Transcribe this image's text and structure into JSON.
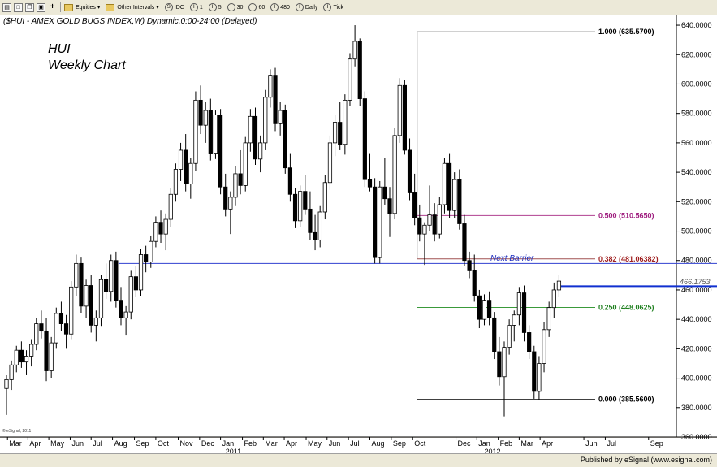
{
  "toolbar": {
    "items": [
      "Equities",
      "Other Intervals",
      "IDC",
      "1",
      "5",
      "30",
      "60",
      "480",
      "Daily",
      "Tick"
    ]
  },
  "chart_data": {
    "type": "candlestick",
    "header": "($HUI - AMEX GOLD BUGS INDEX,W) Dynamic,0:00-24:00 (Delayed)",
    "annotation_title": [
      "HUI",
      "Weekly Chart"
    ],
    "ylim": [
      360,
      645
    ],
    "yticks": [
      360,
      380,
      400,
      420,
      440,
      460,
      480,
      500,
      520,
      540,
      560,
      580,
      600,
      620,
      640
    ],
    "ytick_labels": [
      "360.0000",
      "380.0000",
      "400.0000",
      "420.0000",
      "440.0000",
      "460.0000",
      "480.0000",
      "500.0000",
      "520.0000",
      "540.0000",
      "560.0000",
      "580.0000",
      "600.0000",
      "620.0000",
      "640.0000"
    ],
    "last_price": "466.1753",
    "x_months": [
      {
        "label": "Mar",
        "x": 0.2
      },
      {
        "label": "Apr",
        "x": 4.3
      },
      {
        "label": "May",
        "x": 8.5
      },
      {
        "label": "Jun",
        "x": 12.8
      },
      {
        "label": "Jul",
        "x": 17.0
      },
      {
        "label": "Aug",
        "x": 21.3
      },
      {
        "label": "Sep",
        "x": 25.7
      },
      {
        "label": "Oct",
        "x": 30.0
      },
      {
        "label": "Nov",
        "x": 34.5
      },
      {
        "label": "Dec",
        "x": 38.8
      },
      {
        "label": "Jan",
        "x": 43.0
      },
      {
        "label": "Feb",
        "x": 47.4
      },
      {
        "label": "Mar",
        "x": 51.6
      },
      {
        "label": "Apr",
        "x": 55.8
      },
      {
        "label": "May",
        "x": 60.2
      },
      {
        "label": "Jun",
        "x": 64.4
      },
      {
        "label": "Jul",
        "x": 68.7
      },
      {
        "label": "Aug",
        "x": 73.0
      },
      {
        "label": "Sep",
        "x": 77.3
      },
      {
        "label": "Oct",
        "x": 81.6
      },
      {
        "label": "Dec",
        "x": 90.3
      },
      {
        "label": "Jan",
        "x": 94.5
      },
      {
        "label": "Feb",
        "x": 98.8
      },
      {
        "label": "Mar",
        "x": 103.0
      },
      {
        "label": "Apr",
        "x": 107.2
      },
      {
        "label": "Jun",
        "x": 116.0
      },
      {
        "label": "Jul",
        "x": 120.3
      },
      {
        "label": "Sep",
        "x": 129.0
      }
    ],
    "x_years": [
      {
        "label": "2011",
        "x": 44.0
      },
      {
        "label": "2012",
        "x": 96.0
      }
    ],
    "fib_levels": [
      {
        "label": "1.000 (635.5700)",
        "value": 635.57,
        "x_start": 82.5,
        "color": "#808080",
        "text_color": "#000000"
      },
      {
        "label": "0.500 (510.5650)",
        "value": 510.565,
        "x_start": 82.5,
        "color": "#b04090",
        "text_color": "#a02080"
      },
      {
        "label": "0.382 (481.06382)",
        "value": 481.06382,
        "x_start": 82.5,
        "color": "#a05050",
        "text_color": "#a02020"
      },
      {
        "label": "0.250 (448.0625)",
        "value": 448.0625,
        "x_start": 82.5,
        "color": "#3a9a3a",
        "text_color": "#208020"
      },
      {
        "label": "0.000 (385.5600)",
        "value": 385.56,
        "x_start": 82.5,
        "color": "#000000",
        "text_color": "#000000"
      }
    ],
    "next_barrier": {
      "label": "Next Barrier",
      "value": 478.0,
      "x_start": 22.5,
      "x_end": 144.0
    },
    "resistance": {
      "value": 462.5,
      "x_start": 111.0,
      "x_end": 143.0
    },
    "candles": [
      [
        393,
        402,
        375,
        399
      ],
      [
        399,
        412,
        392,
        409
      ],
      [
        409,
        422,
        404,
        419
      ],
      [
        419,
        425,
        407,
        411
      ],
      [
        411,
        419,
        402,
        415
      ],
      [
        415,
        426,
        408,
        423
      ],
      [
        423,
        441,
        419,
        437
      ],
      [
        437,
        446,
        427,
        432
      ],
      [
        432,
        441,
        398,
        405
      ],
      [
        405,
        428,
        400,
        424
      ],
      [
        424,
        448,
        420,
        444
      ],
      [
        444,
        452,
        432,
        437
      ],
      [
        437,
        443,
        420,
        430
      ],
      [
        430,
        466,
        426,
        462
      ],
      [
        462,
        484,
        456,
        478
      ],
      [
        478,
        482,
        444,
        449
      ],
      [
        449,
        467,
        441,
        463
      ],
      [
        463,
        470,
        431,
        436
      ],
      [
        436,
        446,
        425,
        441
      ],
      [
        441,
        470,
        435,
        467
      ],
      [
        467,
        478,
        454,
        459
      ],
      [
        459,
        484,
        452,
        480
      ],
      [
        480,
        486,
        448,
        453
      ],
      [
        453,
        462,
        436,
        441
      ],
      [
        441,
        449,
        429,
        445
      ],
      [
        445,
        473,
        440,
        469
      ],
      [
        469,
        476,
        455,
        460
      ],
      [
        460,
        488,
        456,
        484
      ],
      [
        484,
        490,
        472,
        479
      ],
      [
        479,
        497,
        475,
        493
      ],
      [
        493,
        510,
        489,
        506
      ],
      [
        506,
        514,
        492,
        498
      ],
      [
        498,
        512,
        487,
        508
      ],
      [
        508,
        529,
        503,
        525
      ],
      [
        525,
        546,
        520,
        542
      ],
      [
        542,
        560,
        534,
        555
      ],
      [
        555,
        566,
        527,
        532
      ],
      [
        532,
        550,
        522,
        546
      ],
      [
        546,
        595,
        541,
        589
      ],
      [
        589,
        599,
        566,
        572
      ],
      [
        572,
        588,
        560,
        582
      ],
      [
        582,
        590,
        548,
        553
      ],
      [
        553,
        582,
        549,
        579
      ],
      [
        579,
        583,
        525,
        530
      ],
      [
        530,
        539,
        510,
        515
      ],
      [
        515,
        527,
        498,
        523
      ],
      [
        523,
        544,
        517,
        539
      ],
      [
        539,
        555,
        525,
        531
      ],
      [
        531,
        564,
        527,
        560
      ],
      [
        560,
        583,
        554,
        578
      ],
      [
        578,
        584,
        545,
        549
      ],
      [
        549,
        565,
        540,
        560
      ],
      [
        560,
        596,
        555,
        591
      ],
      [
        591,
        610,
        584,
        606
      ],
      [
        606,
        611,
        568,
        573
      ],
      [
        573,
        588,
        565,
        582
      ],
      [
        582,
        586,
        539,
        543
      ],
      [
        543,
        553,
        520,
        525
      ],
      [
        525,
        529,
        502,
        507
      ],
      [
        507,
        531,
        503,
        527
      ],
      [
        527,
        538,
        511,
        515
      ],
      [
        515,
        527,
        494,
        499
      ],
      [
        499,
        511,
        487,
        494
      ],
      [
        494,
        517,
        489,
        513
      ],
      [
        513,
        538,
        508,
        533
      ],
      [
        533,
        565,
        528,
        560
      ],
      [
        560,
        579,
        551,
        574
      ],
      [
        574,
        588,
        555,
        559
      ],
      [
        559,
        593,
        552,
        589
      ],
      [
        589,
        621,
        585,
        617
      ],
      [
        617,
        640,
        612,
        629
      ],
      [
        629,
        631,
        585,
        590
      ],
      [
        590,
        595,
        530,
        535
      ],
      [
        535,
        553,
        527,
        530
      ],
      [
        530,
        536,
        478,
        482
      ],
      [
        482,
        534,
        478,
        530
      ],
      [
        530,
        550,
        518,
        522
      ],
      [
        522,
        530,
        496,
        512
      ],
      [
        512,
        570,
        508,
        565
      ],
      [
        565,
        604,
        560,
        599
      ],
      [
        599,
        603,
        552,
        555
      ],
      [
        555,
        563,
        521,
        526
      ],
      [
        526,
        539,
        504,
        509
      ],
      [
        509,
        518,
        493,
        498
      ],
      [
        498,
        506,
        477,
        504
      ],
      [
        504,
        531,
        500,
        511
      ],
      [
        511,
        519,
        493,
        498
      ],
      [
        498,
        523,
        495,
        518
      ],
      [
        518,
        550,
        512,
        546
      ],
      [
        546,
        553,
        509,
        514
      ],
      [
        514,
        540,
        509,
        535
      ],
      [
        535,
        542,
        501,
        505
      ],
      [
        505,
        511,
        476,
        480
      ],
      [
        480,
        486,
        468,
        473
      ],
      [
        473,
        484,
        452,
        456
      ],
      [
        456,
        460,
        434,
        440
      ],
      [
        440,
        457,
        436,
        453
      ],
      [
        453,
        459,
        436,
        441
      ],
      [
        441,
        445,
        413,
        418
      ],
      [
        418,
        428,
        395,
        401
      ],
      [
        401,
        425,
        374,
        421
      ],
      [
        421,
        440,
        416,
        436
      ],
      [
        436,
        446,
        425,
        443
      ],
      [
        443,
        462,
        436,
        458
      ],
      [
        458,
        463,
        425,
        431
      ],
      [
        431,
        436,
        413,
        418
      ],
      [
        418,
        422,
        386,
        391
      ],
      [
        391,
        415,
        385,
        410
      ],
      [
        410,
        438,
        404,
        433
      ],
      [
        433,
        452,
        428,
        448
      ],
      [
        448,
        465,
        441,
        460
      ],
      [
        460,
        470,
        455,
        466
      ]
    ],
    "footer": "Published by eSignal (www.esignal.com)",
    "watermark": "© eSignal, 2011"
  }
}
